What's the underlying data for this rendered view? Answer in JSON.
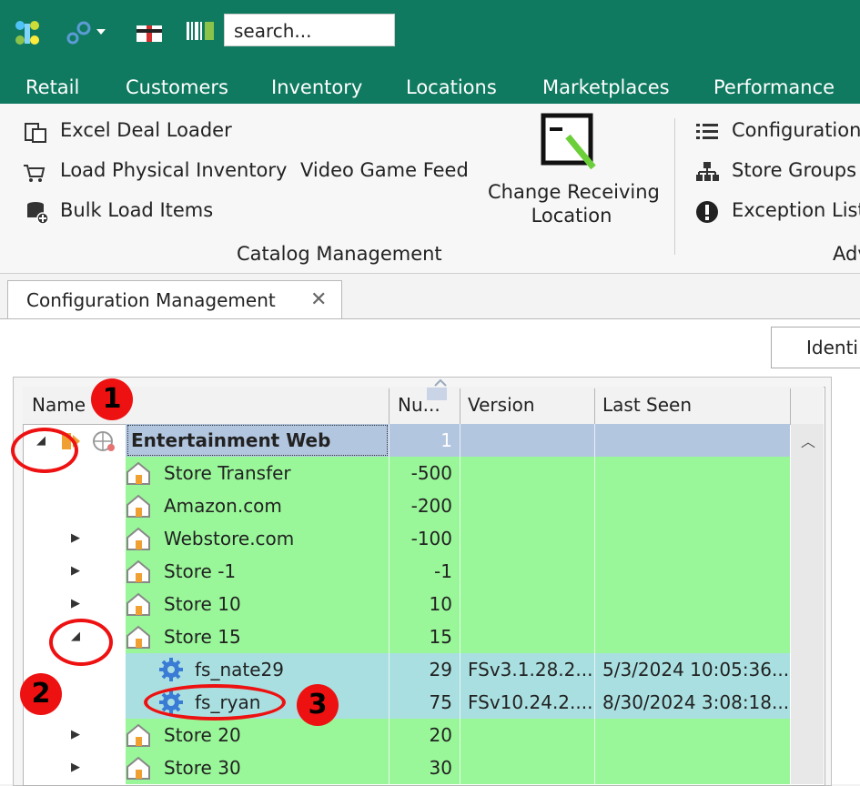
{
  "topbar": {
    "search_placeholder": "search..."
  },
  "menu": [
    "Retail",
    "Customers",
    "Inventory",
    "Locations",
    "Marketplaces",
    "Performance"
  ],
  "ribbon": {
    "excel_deal_loader": "Excel Deal Loader",
    "load_physical_inventory": "Load Physical Inventory",
    "video_game_feed": "Video Game Feed",
    "bulk_load_items": "Bulk Load Items",
    "change_receiving_location_1": "Change Receiving",
    "change_receiving_location_2": "Location",
    "group_catalog": "Catalog Management",
    "configuration": "Configuration",
    "store_groups": "Store Groups",
    "exception_list": "Exception List",
    "group_adv": "Adv"
  },
  "tab": {
    "label": "Configuration Management",
    "close": "✕"
  },
  "identity_button": "Identi",
  "grid": {
    "columns": {
      "name": "Name",
      "num": "Nu...",
      "version": "Version",
      "last_seen": "Last Seen"
    },
    "rows": [
      {
        "name": "Entertainment Web",
        "num": "1",
        "version": "",
        "last_seen": ""
      },
      {
        "name": "Store Transfer",
        "num": "-500",
        "version": "",
        "last_seen": ""
      },
      {
        "name": "Amazon.com",
        "num": "-200",
        "version": "",
        "last_seen": ""
      },
      {
        "name": "Webstore.com",
        "num": "-100",
        "version": "",
        "last_seen": ""
      },
      {
        "name": "Store -1",
        "num": "-1",
        "version": "",
        "last_seen": ""
      },
      {
        "name": "Store 10",
        "num": "10",
        "version": "",
        "last_seen": ""
      },
      {
        "name": "Store 15",
        "num": "15",
        "version": "",
        "last_seen": ""
      },
      {
        "name": "fs_nate29",
        "num": "29",
        "version": "FSv3.1.28.2...",
        "last_seen": "5/3/2024 10:05:36..."
      },
      {
        "name": "fs_ryan",
        "num": "75",
        "version": "FSv10.24.2....",
        "last_seen": "8/30/2024 3:08:18..."
      },
      {
        "name": "Store 20",
        "num": "20",
        "version": "",
        "last_seen": ""
      },
      {
        "name": "Store 30",
        "num": "30",
        "version": "",
        "last_seen": ""
      }
    ]
  },
  "annotations": [
    "1",
    "2",
    "3"
  ],
  "colors": {
    "header_green": "#0f7a60",
    "row_green": "#99f799",
    "row_cyan": "#a9dfe0",
    "row_selected": "#b3c6e0",
    "annotation_red": "#e11111"
  }
}
